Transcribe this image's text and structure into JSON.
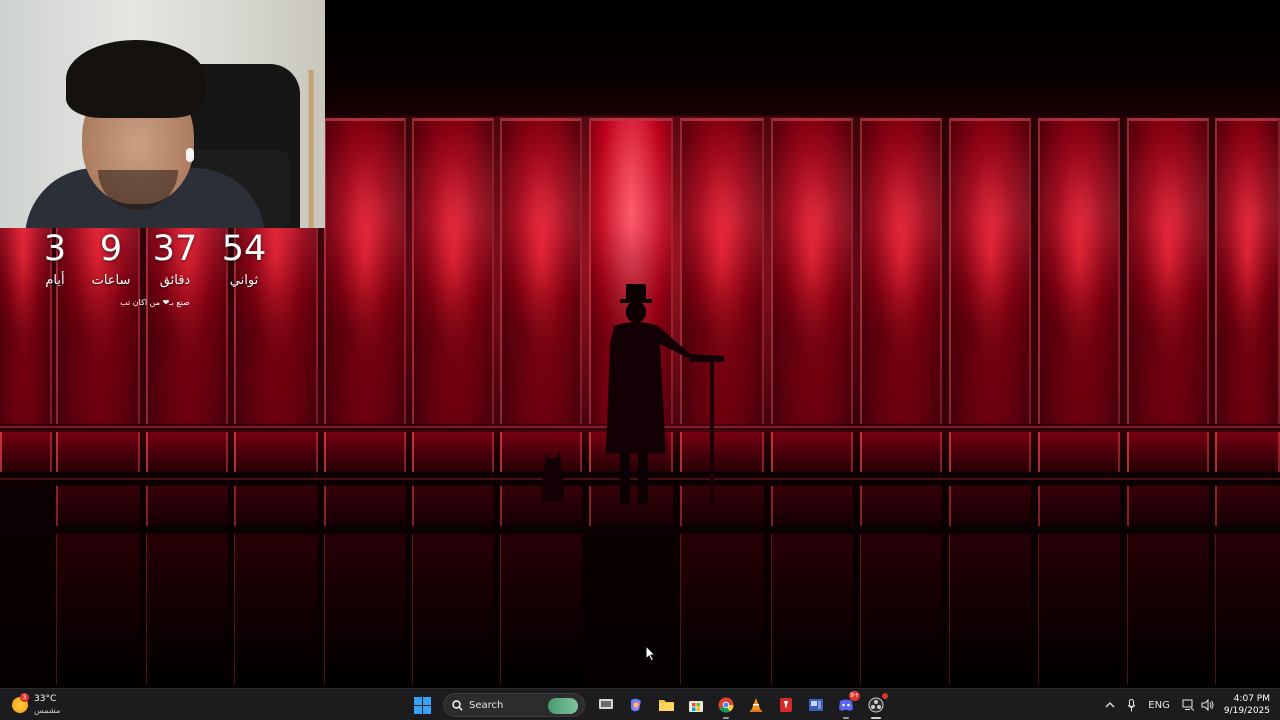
{
  "countdown": {
    "days": {
      "value": "3",
      "label": "أيام"
    },
    "hours": {
      "value": "9",
      "label": "ساعات"
    },
    "minutes": {
      "value": "37",
      "label": "دقائق"
    },
    "seconds": {
      "value": "54",
      "label": "ثواني"
    },
    "credit": "صنع بـ❤ من اكان تب"
  },
  "taskbar": {
    "weather": {
      "temp": "33°C",
      "condition": "مشمس",
      "badge": "3"
    },
    "search_label": "Search",
    "apps": [
      {
        "name": "start",
        "icon": "windows-icon"
      },
      {
        "name": "task-view",
        "icon": "task-view-icon"
      },
      {
        "name": "copilot",
        "icon": "copilot-icon"
      },
      {
        "name": "file-explorer",
        "icon": "folder-icon"
      },
      {
        "name": "microsoft-store",
        "icon": "store-icon"
      },
      {
        "name": "chrome",
        "icon": "chrome-icon"
      },
      {
        "name": "vlc",
        "icon": "cone-icon"
      },
      {
        "name": "app-red",
        "icon": "red-app-icon"
      },
      {
        "name": "app-blue",
        "icon": "blue-app-icon"
      },
      {
        "name": "discord",
        "icon": "discord-icon",
        "badge": "9+"
      },
      {
        "name": "obs",
        "icon": "record-icon"
      }
    ],
    "tray": {
      "language": "ENG",
      "time": "4:07 PM",
      "date": "9/19/2025"
    }
  },
  "colors": {
    "accent_red": "#e0122e",
    "taskbar_bg": "#1c1c1e",
    "windows_blue": "#38a2f5"
  }
}
